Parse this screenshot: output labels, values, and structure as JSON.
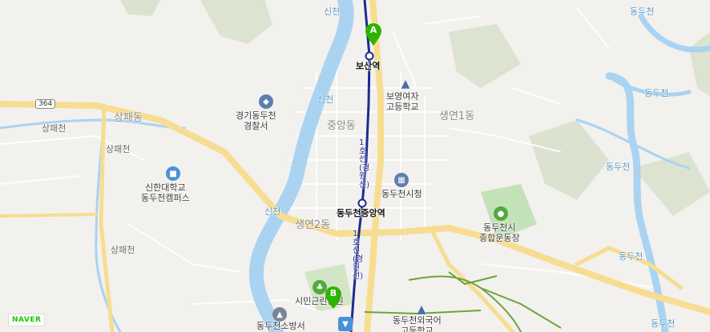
{
  "map": {
    "route_shield": "364",
    "brand": "NAVER",
    "colors": {
      "land": "#f2f1ee",
      "water": "#a9d3f1",
      "main_road": "#f7dd91",
      "road": "#ffffff",
      "subway_line": "#1d2b8f",
      "forest": "#d6dfc9",
      "trail": "#6ea33a",
      "marker": "#2db400"
    },
    "markers": [
      {
        "letter": "A",
        "icon": "map-pin-icon"
      },
      {
        "letter": "B",
        "icon": "map-pin-icon"
      }
    ],
    "stations": [
      {
        "name": "보산역"
      },
      {
        "name": "동두천중앙역"
      }
    ],
    "rail_labels": [
      "1호선(경원선)",
      "1호선(경원선)"
    ],
    "areas": [
      "중앙동",
      "상패동",
      "생연1동",
      "생연2동"
    ],
    "rivers": [
      "신천",
      "신천",
      "신천",
      "동두천",
      "동두천",
      "동두천",
      "동두천",
      "동두천"
    ],
    "roads": [
      "상패천",
      "상패천",
      "상패천"
    ],
    "pois": [
      {
        "name": "보영여자\n고등학교",
        "icon": "school-icon"
      },
      {
        "name": "경기동두천\n경찰서",
        "icon": "police-icon"
      },
      {
        "name": "신한대학교\n동두천캠퍼스",
        "icon": "university-icon"
      },
      {
        "name": "동두천시청",
        "icon": "city-hall-icon"
      },
      {
        "name": "동두천시\n종합운동장",
        "icon": "stadium-icon"
      },
      {
        "name": "시민근린공원",
        "icon": "park-icon"
      },
      {
        "name": "동두천소방서",
        "icon": "fire-station-icon"
      },
      {
        "name": "동두천외국어\n고등학교",
        "icon": "school-icon"
      }
    ]
  }
}
